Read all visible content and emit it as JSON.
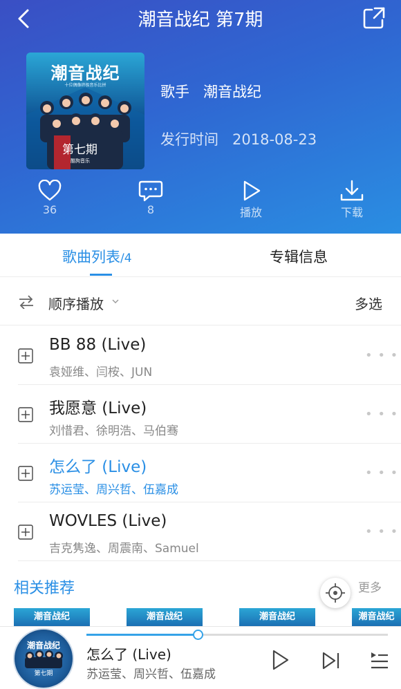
{
  "header": {
    "title": "潮音战纪 第7期",
    "cover": {
      "title": "潮音战纪",
      "subtitle": "十位偶像终极音乐比拼",
      "episode_tag": "第七期",
      "logo_text": "酷狗音乐"
    },
    "singer_label": "歌手",
    "singer": "潮音战纪",
    "release_label": "发行时间",
    "release_date": "2018-08-23",
    "actions": [
      {
        "icon": "heart-icon",
        "label": "36"
      },
      {
        "icon": "comment-icon",
        "label": "8"
      },
      {
        "icon": "play-icon",
        "label": "播放"
      },
      {
        "icon": "download-icon",
        "label": "下载"
      }
    ]
  },
  "tabs": {
    "songs_label": "歌曲列表",
    "songs_count": "/4",
    "info_label": "专辑信息"
  },
  "toolbar": {
    "order_label": "顺序播放",
    "multi_label": "多选"
  },
  "songs": [
    {
      "name": "BB 88 (Live)",
      "artists": "袁娅维、闫桉、JUN",
      "active": false
    },
    {
      "name": "我愿意 (Live)",
      "artists": "刘惜君、徐明浩、马伯骞",
      "active": false
    },
    {
      "name": "怎么了 (Live)",
      "artists": "苏运莹、周兴哲、伍嘉成",
      "active": true
    },
    {
      "name": "WOVLES (Live)",
      "artists": "吉克隽逸、周震南、Samuel",
      "active": false
    }
  ],
  "more_glyph": "• • •",
  "related": {
    "title": "相关推荐",
    "more": "更多",
    "thumbs": [
      "潮音战纪",
      "潮音战纪",
      "潮音战纪",
      "潮音战纪"
    ]
  },
  "player": {
    "title": "怎么了 (Live)",
    "artists": "苏运莹、周兴哲、伍嘉成",
    "progress": 0.37,
    "disc_title": "潮音战纪",
    "disc_ep": "第七期"
  },
  "colors": {
    "accent": "#2a8fe5",
    "header_start": "#3a4fc4",
    "header_end": "#2a8ee2"
  }
}
